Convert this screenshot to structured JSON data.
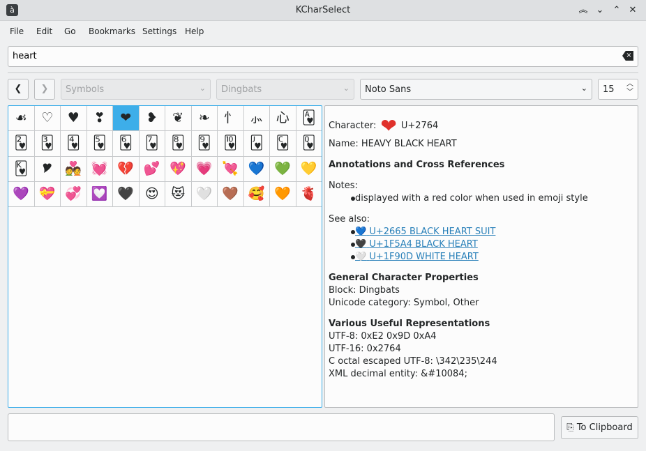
{
  "window": {
    "title": "KCharSelect",
    "app_icon": "à"
  },
  "menu": [
    "File",
    "Edit",
    "Go",
    "Bookmarks",
    "Settings",
    "Help"
  ],
  "search": {
    "value": "heart"
  },
  "toolbar": {
    "section": "Symbols",
    "block": "Dingbats",
    "font": "Noto Sans",
    "size": "15"
  },
  "grid": {
    "selected_index": 4,
    "chars": [
      "☙",
      "♡",
      "♥",
      "❣",
      "❤",
      "❥",
      "❦",
      "❧",
      "⺖",
      "⺗",
      "⼼",
      "🂱",
      "🂲",
      "🂳",
      "🂴",
      "🂵",
      "🂶",
      "🂷",
      "🂸",
      "🂹",
      "🂺",
      "🂻",
      "🂼",
      "🂽",
      "🂾",
      "🎔",
      "💑",
      "💓",
      "💔",
      "💕",
      "💖",
      "💗",
      "💘",
      "💙",
      "💚",
      "💛",
      "💜",
      "💝",
      "💞",
      "💟",
      "🖤",
      "😍",
      "😻",
      "🤍",
      "🤎",
      "🥰",
      "🧡",
      "🫀"
    ]
  },
  "info": {
    "character_label": "Character:",
    "character": "❤",
    "code": "U+2764",
    "name": "Name: HEAVY BLACK HEART",
    "annotations_heading": "Annotations and Cross References",
    "notes_label": "Notes:",
    "notes": [
      "displayed with a red color when used in emoji style"
    ],
    "see_also_label": "See also:",
    "see_also": [
      {
        "glyph": "💙",
        "text": "U+2665 BLACK HEART SUIT"
      },
      {
        "glyph": "🖤",
        "text": "U+1F5A4 BLACK HEART"
      },
      {
        "glyph": "🤍",
        "text": "U+1F90D WHITE HEART"
      }
    ],
    "general_heading": "General Character Properties",
    "block": "Block: Dingbats",
    "category": "Unicode category: Symbol, Other",
    "repr_heading": "Various Useful Representations",
    "utf8": "UTF-8: 0xE2 0x9D 0xA4",
    "utf16": "UTF-16: 0x2764",
    "octal": "C octal escaped UTF-8: \\342\\235\\244",
    "xml": "XML decimal entity: &#10084;"
  },
  "clipboard_button": "To Clipboard"
}
